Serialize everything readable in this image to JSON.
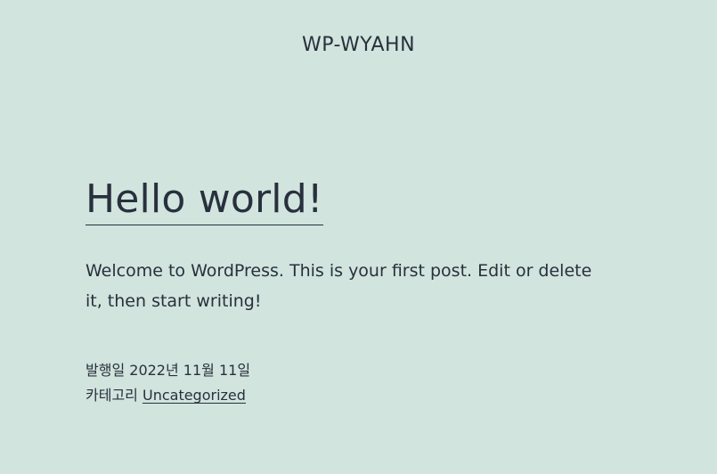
{
  "site": {
    "title": "WP-WYAHN"
  },
  "post": {
    "title": "Hello world!",
    "content": "Welcome to WordPress. This is your first post. Edit or delete it, then start writing!",
    "meta": {
      "published_label": "발행일",
      "published_date": "2022년 11월 11일",
      "category_label": "카테고리",
      "category": "Uncategorized"
    }
  },
  "colors": {
    "background": "#d1e4dd",
    "text": "#28303d"
  }
}
